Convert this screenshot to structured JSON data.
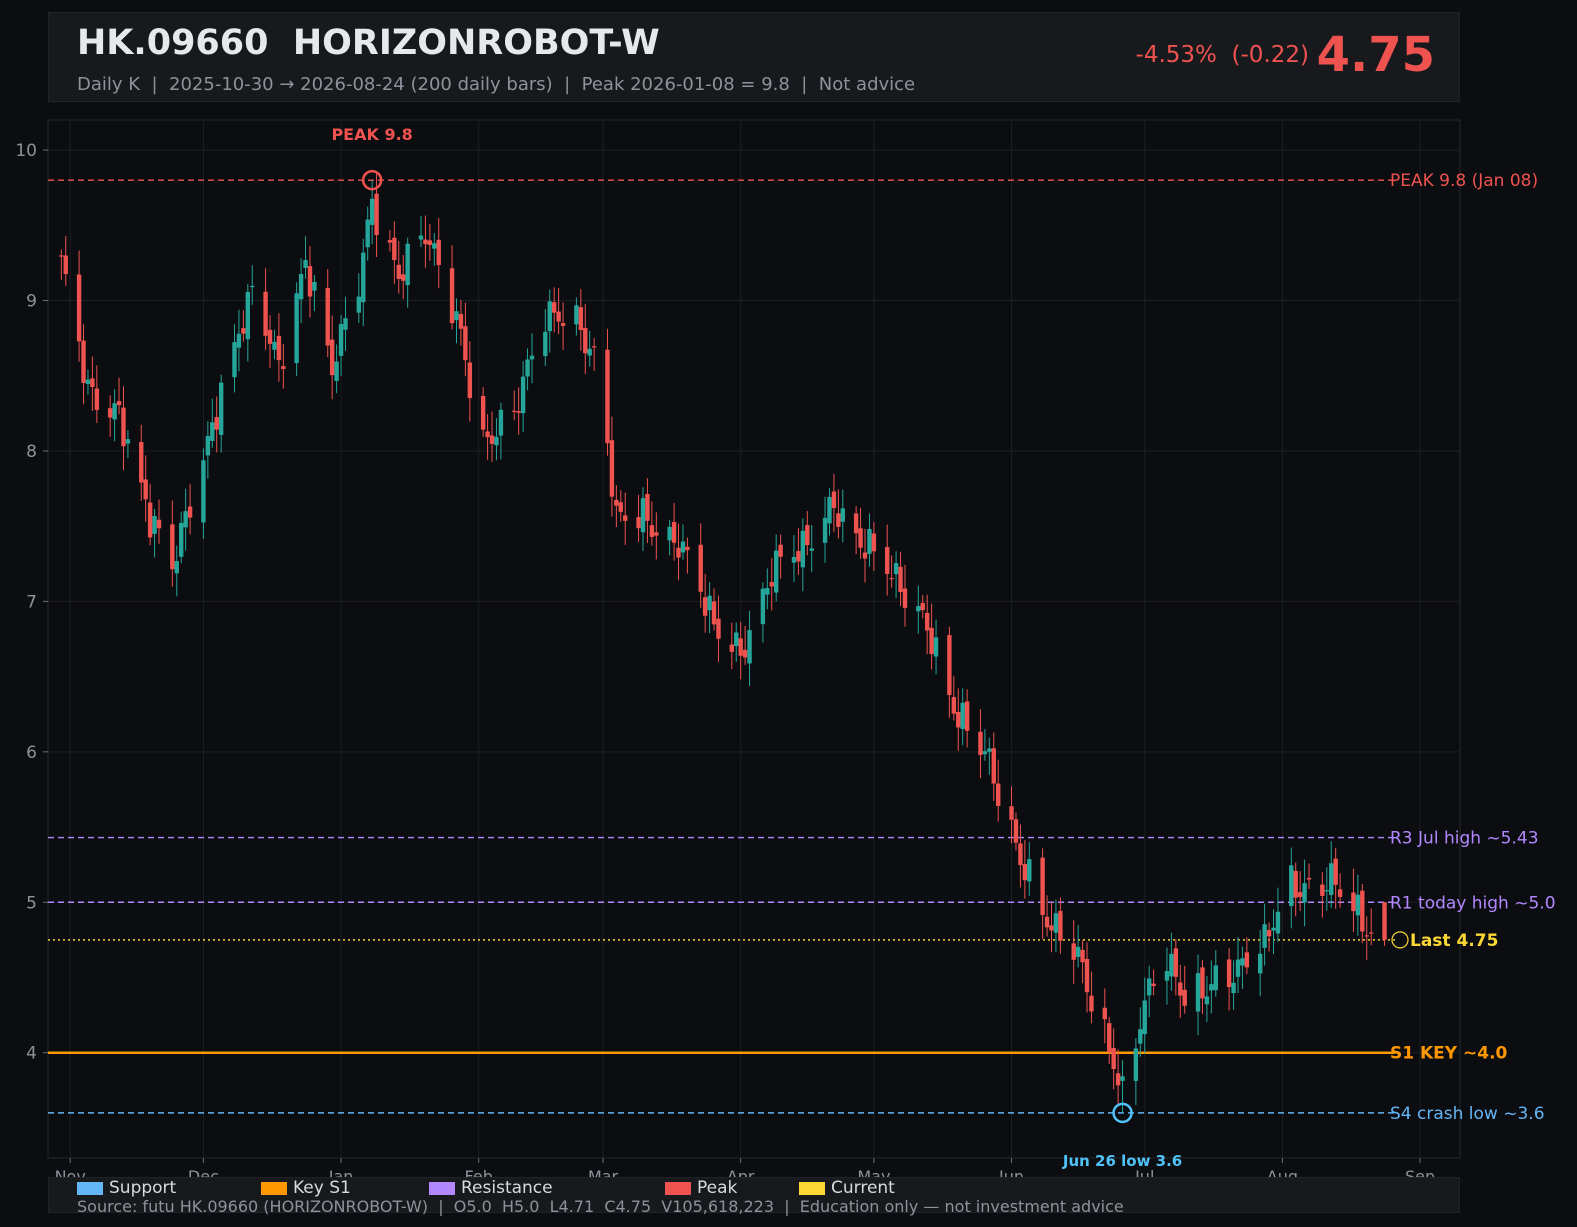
{
  "header": {
    "ticker": "HK.09660  HORIZONROBOT-W",
    "subtitle": "Daily K  |  2025-10-30 → 2026-08-24 (200 daily bars)  |  Peak 2026-01-08 = 9.8  |  Not advice",
    "change": "-4.53%  (-0.22)",
    "price": "4.75"
  },
  "colors": {
    "up": "#26a69a",
    "down": "#ef5350",
    "support": "#64b5f6",
    "key_s1": "#ff9800",
    "resistance": "#b388ff",
    "peak": "#ef5350",
    "current": "#fdd835"
  },
  "legend": {
    "items": [
      {
        "label": "Support",
        "color": "#64b5f6"
      },
      {
        "label": "Key S1",
        "color": "#ff9800"
      },
      {
        "label": "Resistance",
        "color": "#b388ff"
      },
      {
        "label": "Peak",
        "color": "#ef5350"
      },
      {
        "label": "Current",
        "color": "#fdd835"
      }
    ],
    "source": "Source: futu HK.09660 (HORIZONROBOT-W)  |  O5.0  H5.0  L4.71  C4.75  V105,618,223  |  Education only — not investment advice"
  },
  "chart_data": {
    "type": "candlestick",
    "title": "HK.09660  HORIZONROBOT-W",
    "ylim": [
      3.3,
      10.2
    ],
    "xlim": [
      "2025-10-27",
      "2026-09-10"
    ],
    "yticks": [
      4,
      5,
      6,
      7,
      8,
      9,
      10
    ],
    "xticks": [
      {
        "label": "Nov",
        "date": "2025-11-01"
      },
      {
        "label": "Dec",
        "date": "2025-12-01"
      },
      {
        "label": "Jan",
        "date": "2026-01-01"
      },
      {
        "label": "Feb",
        "date": "2026-02-01"
      },
      {
        "label": "Mar",
        "date": "2026-03-01"
      },
      {
        "label": "Apr",
        "date": "2026-04-01"
      },
      {
        "label": "May",
        "date": "2026-05-01"
      },
      {
        "label": "Jun",
        "date": "2026-06-01"
      },
      {
        "label": "Jul",
        "date": "2026-07-01"
      },
      {
        "label": "Aug",
        "date": "2026-08-01"
      },
      {
        "label": "Sep",
        "date": "2026-09-01"
      }
    ],
    "grid": true,
    "close_anchors": [
      [
        "2025-10-30",
        9.2
      ],
      [
        "2025-11-05",
        8.4
      ],
      [
        "2025-11-12",
        8.3
      ],
      [
        "2025-11-19",
        7.5
      ],
      [
        "2025-11-24",
        7.2
      ],
      [
        "2025-11-28",
        7.7
      ],
      [
        "2025-12-05",
        8.4
      ],
      [
        "2025-12-12",
        9.0
      ],
      [
        "2025-12-18",
        8.6
      ],
      [
        "2025-12-24",
        9.3
      ],
      [
        "2025-12-30",
        8.5
      ],
      [
        "2026-01-05",
        9.1
      ],
      [
        "2026-01-08",
        9.7
      ],
      [
        "2026-01-14",
        9.2
      ],
      [
        "2026-01-20",
        9.4
      ],
      [
        "2026-01-28",
        8.8
      ],
      [
        "2026-02-02",
        8.1
      ],
      [
        "2026-02-09",
        8.2
      ],
      [
        "2026-02-16",
        8.9
      ],
      [
        "2026-02-22",
        9.0
      ],
      [
        "2026-02-28",
        8.5
      ],
      [
        "2026-03-04",
        7.5
      ],
      [
        "2026-03-10",
        7.6
      ],
      [
        "2026-03-18",
        7.4
      ],
      [
        "2026-03-26",
        6.8
      ],
      [
        "2026-04-01",
        6.7
      ],
      [
        "2026-04-08",
        7.2
      ],
      [
        "2026-04-15",
        7.3
      ],
      [
        "2026-04-22",
        7.7
      ],
      [
        "2026-04-28",
        7.4
      ],
      [
        "2026-05-06",
        7.1
      ],
      [
        "2026-05-13",
        6.9
      ],
      [
        "2026-05-20",
        6.2
      ],
      [
        "2026-05-27",
        5.9
      ],
      [
        "2026-06-01",
        5.5
      ],
      [
        "2026-06-05",
        5.2
      ],
      [
        "2026-06-10",
        4.8
      ],
      [
        "2026-06-16",
        4.6
      ],
      [
        "2026-06-20",
        4.3
      ],
      [
        "2026-06-24",
        4.0
      ],
      [
        "2026-06-26",
        3.75
      ],
      [
        "2026-06-30",
        4.2
      ],
      [
        "2026-07-05",
        4.6
      ],
      [
        "2026-07-10",
        4.4
      ],
      [
        "2026-07-16",
        4.5
      ],
      [
        "2026-07-22",
        4.5
      ],
      [
        "2026-07-28",
        4.7
      ],
      [
        "2026-08-02",
        5.2
      ],
      [
        "2026-08-07",
        5.1
      ],
      [
        "2026-08-12",
        5.1
      ],
      [
        "2026-08-18",
        4.9
      ],
      [
        "2026-08-24",
        4.75
      ]
    ],
    "peak": {
      "date": "2026-01-08",
      "value": 9.8,
      "label": "PEAK 9.8"
    },
    "low": {
      "date": "2026-06-26",
      "value": 3.6,
      "label": "Jun 26 low 3.6"
    },
    "levels": [
      {
        "name": "peak",
        "value": 9.8,
        "label": "PEAK 9.8 (Jan 08)",
        "color": "#ef5350",
        "style": "dashed"
      },
      {
        "name": "r3",
        "value": 5.43,
        "label": "R3 Jul high ~5.43",
        "color": "#b388ff",
        "style": "dashed"
      },
      {
        "name": "r1",
        "value": 5.0,
        "label": "R1 today high ~5.0",
        "color": "#b388ff",
        "style": "dashed"
      },
      {
        "name": "last",
        "value": 4.75,
        "label": "Last 4.75",
        "color": "#fdd835",
        "style": "dotted"
      },
      {
        "name": "s1",
        "value": 4.0,
        "label": "S1 KEY ~4.0",
        "color": "#ff9800",
        "style": "solid"
      },
      {
        "name": "s4",
        "value": 3.6,
        "label": "S4 crash low ~3.6",
        "color": "#64b5f6",
        "style": "dashed"
      }
    ],
    "last": {
      "open": 5.0,
      "high": 5.0,
      "low": 4.71,
      "close": 4.75,
      "volume": 105618223
    }
  }
}
